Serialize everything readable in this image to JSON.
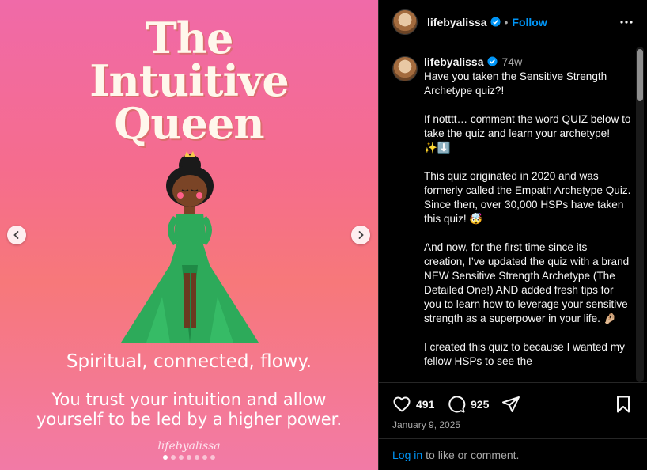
{
  "image": {
    "title_lines": [
      "The",
      "Intuitive",
      "Queen"
    ],
    "subtitle": "Spiritual, connected, flowy.",
    "body_lines": [
      "You trust your intuition and allow",
      "yourself to be led by a higher power."
    ],
    "watermark": "lifebyalissa",
    "slide_count": 7,
    "active_slide": 1
  },
  "header": {
    "username": "lifebyalissa",
    "separator": "•",
    "follow_label": "Follow"
  },
  "caption": {
    "username": "lifebyalissa",
    "time_ago": "74w",
    "text": "Have you taken the Sensitive Strength Archetype quiz?!\n\nIf notttt… comment the word QUIZ below to take the quiz and learn your archetype! ✨⬇️\n\nThis quiz originated in 2020 and was formerly called the Empath Archetype Quiz. Since then, over 30,000 HSPs have taken this quiz! 🤯\n\nAnd now, for the first time since its creation, I’ve updated the quiz with a brand NEW Sensitive Strength Archetype (The Detailed One!) AND added fresh tips for you to learn how to leverage your sensitive strength as a superpower in your life. 🤌🏼\n\nI created this quiz to because I wanted my fellow HSPs to see the"
  },
  "actions": {
    "like_count": "491",
    "comment_count": "925",
    "date": "January 9, 2025"
  },
  "footer": {
    "login_label": "Log in",
    "rest": "to like or comment."
  },
  "colors": {
    "link": "#0095f6",
    "background": "#000000",
    "image_pink": "#f06aa8",
    "dress_green": "#2daa5a"
  }
}
